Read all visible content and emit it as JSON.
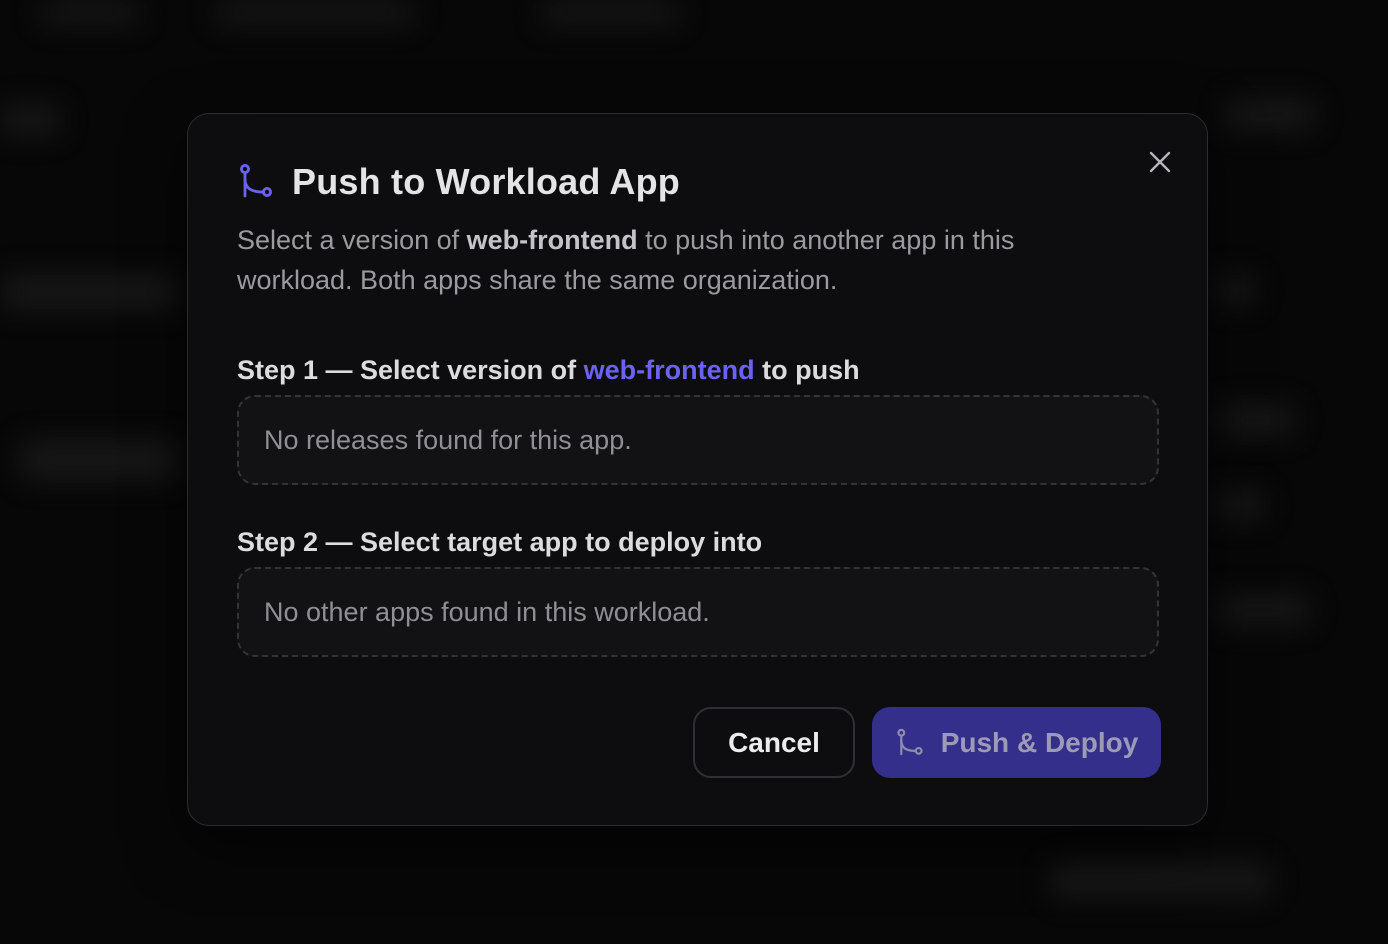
{
  "dialog": {
    "title": "Push to Workload App",
    "description": {
      "prefix": "Select a version of ",
      "app_name": "web-frontend",
      "suffix": " to push into another app in this workload. Both apps share the same organization."
    },
    "close_icon": "close-icon",
    "title_icon": "git-branch-icon"
  },
  "step1": {
    "label_prefix": "Step 1 — Select version of ",
    "label_app": "web-frontend",
    "label_suffix": " to push",
    "empty_message": "No releases found for this app."
  },
  "step2": {
    "label": "Step 2 — Select target app to deploy into",
    "empty_message": "No other apps found in this workload."
  },
  "actions": {
    "cancel_label": "Cancel",
    "push_label": "Push & Deploy",
    "push_icon": "git-branch-icon"
  },
  "colors": {
    "accent": "#6b63f0",
    "primary_button_bg": "#342f8a",
    "modal_bg": "#0d0d0f"
  }
}
